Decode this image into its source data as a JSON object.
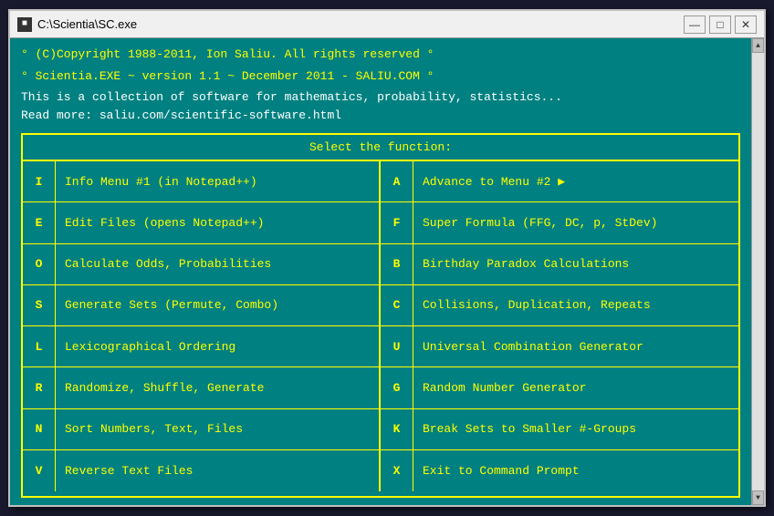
{
  "window": {
    "title": "C:\\Scientia\\SC.exe",
    "icon_char": "■"
  },
  "title_buttons": {
    "minimize": "—",
    "maximize": "□",
    "close": "✕"
  },
  "header": {
    "line1": "° (C)Copyright 1988-2011, Ion Saliu. All rights reserved  °",
    "line2": "° Scientia.EXE ~ version 1.1 ~ December 2011 - SALIU.COM °",
    "line3": "This is a collection of software for mathematics, probability, statistics...",
    "line4": "Read more: saliu.com/scientific-software.html"
  },
  "menu": {
    "title": "Select the function:",
    "left": [
      {
        "key": "I",
        "label": "Info Menu #1 (in Notepad++)"
      },
      {
        "key": "E",
        "label": "Edit Files (opens Notepad++)"
      },
      {
        "key": "O",
        "label": "Calculate Odds, Probabilities"
      },
      {
        "key": "S",
        "label": "Generate Sets (Permute, Combo)"
      },
      {
        "key": "L",
        "label": "Lexicographical Ordering"
      },
      {
        "key": "R",
        "label": "Randomize, Shuffle, Generate"
      },
      {
        "key": "N",
        "label": "Sort Numbers, Text, Files"
      },
      {
        "key": "V",
        "label": "Reverse Text Files"
      }
    ],
    "right": [
      {
        "key": "A",
        "label": "Advance to Menu #2 ▶"
      },
      {
        "key": "F",
        "label": "Super Formula (FFG, DC, p, StDev)"
      },
      {
        "key": "B",
        "label": "Birthday Paradox Calculations"
      },
      {
        "key": "C",
        "label": "Collisions, Duplication, Repeats"
      },
      {
        "key": "U",
        "label": "Universal Combination Generator"
      },
      {
        "key": "G",
        "label": "Random Number Generator"
      },
      {
        "key": "K",
        "label": "Break Sets to Smaller #-Groups"
      },
      {
        "key": "X",
        "label": "Exit to Command Prompt"
      }
    ]
  }
}
